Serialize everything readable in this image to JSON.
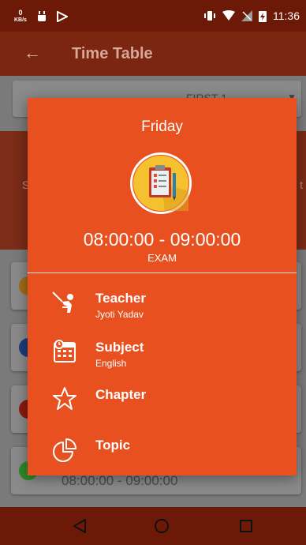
{
  "status_bar": {
    "net_speed_value": "0",
    "net_speed_unit": "KB/s",
    "time": "11:36"
  },
  "app_bar": {
    "title": "Time Table"
  },
  "background": {
    "dropdown_value": "FIRST 1",
    "band_left": "S",
    "band_right": "t",
    "cards": [
      {
        "dot_color": "#a26a1a",
        "text": ""
      },
      {
        "dot_color": "#1c3c7a",
        "text": ""
      },
      {
        "dot_color": "#8a1a10",
        "text": ""
      },
      {
        "dot_color": "#2c8a2c",
        "text": "08:00:00 - 09:00:00"
      }
    ]
  },
  "modal": {
    "day": "Friday",
    "time_range": "08:00:00 - 09:00:00",
    "period_type": "EXAM",
    "details": [
      {
        "icon": "teacher-icon",
        "label": "Teacher",
        "value": "Jyoti Yadav"
      },
      {
        "icon": "calendar-icon",
        "label": "Subject",
        "value": "English"
      },
      {
        "icon": "star-outline-icon",
        "label": "Chapter",
        "value": ""
      },
      {
        "icon": "pie-chart-icon",
        "label": "Topic",
        "value": ""
      }
    ]
  },
  "colors": {
    "modal_bg": "#e8501f",
    "status_bar": "#6c1a07",
    "app_bar": "#7a2611"
  }
}
